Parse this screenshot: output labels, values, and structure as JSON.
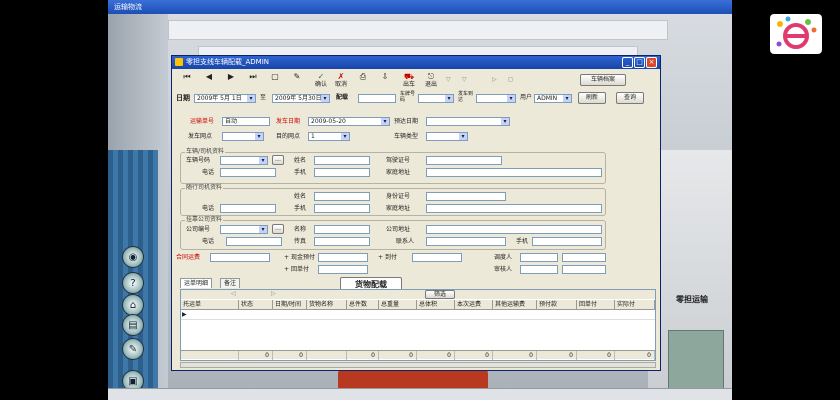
{
  "background": {
    "title": "运输物流",
    "right_label": "零担运输"
  },
  "dialog": {
    "title": "零担支线车辆配载_ADMIN",
    "toolbar": [
      {
        "label": "",
        "icon": "first-icon"
      },
      {
        "label": "",
        "icon": "prev-icon"
      },
      {
        "label": "",
        "icon": "next-icon"
      },
      {
        "label": "",
        "icon": "last-icon"
      },
      {
        "label": "",
        "icon": "new-icon"
      },
      {
        "label": "",
        "icon": "edit-icon"
      },
      {
        "label": "确认",
        "icon": "confirm-icon"
      },
      {
        "label": "取消",
        "icon": "cancel-icon"
      },
      {
        "label": "",
        "icon": "print-icon"
      },
      {
        "label": "",
        "icon": "export-icon"
      },
      {
        "label": "出车",
        "icon": "depart-icon"
      },
      {
        "label": "退出",
        "icon": "exit-icon"
      }
    ],
    "toolbar_right_button": "车辆档案",
    "filter": {
      "date_from_label": "日期",
      "date_from": "2009年 5月 1日",
      "date_to_label": "至",
      "date_to": "2009年 5月30日",
      "waybill_label": "配载",
      "plate_label": "车牌号码",
      "driver_label": "发车到达",
      "user_label": "用户",
      "user_value": "ADMIN",
      "search_button": "刷新",
      "query_button": "查询"
    },
    "form": {
      "dispatch_no_label": "运输单号",
      "dispatch_no": "自动",
      "depart_date_label": "发车日期",
      "depart_date": "2009-05-20",
      "arrive_date_label": "预达日期",
      "origin_label": "发车网点",
      "dest_label": "目的网点",
      "dest_value": "1",
      "vehicle_type_label": "车辆类型"
    },
    "group_vehicle": {
      "title": "车辆/司机资料",
      "plate_label": "车辆号码",
      "name_label": "姓名",
      "license_label": "驾驶证号",
      "phone_label": "电话",
      "mobile_label": "手机",
      "address_label": "家庭地址"
    },
    "group_escort": {
      "title": "随行司机资料",
      "name_label": "姓名",
      "id_label": "身份证号",
      "phone_label": "电话",
      "mobile_label": "手机",
      "address_label": "家庭地址"
    },
    "group_company": {
      "title": "挂靠公司资料",
      "code_label": "公司编号",
      "name_label": "名称",
      "address_label": "公司地址",
      "phone_label": "电话",
      "fax_label": "传真",
      "contact_label": "联系人",
      "mobile_label": "手机"
    },
    "settlement": {
      "contract_label": "合同运费",
      "prepay_label": "现金预付",
      "arrive_pay_label": "到付",
      "return_label": "回单付",
      "loader_label": "调度人",
      "checker_label": "审核人"
    },
    "tabs": [
      "运单明细",
      "备注"
    ],
    "overlay_button": "货物配载",
    "filter_tab": "筛选",
    "table": {
      "headers": [
        "托运单",
        "状态",
        "日期/时间",
        "货物名称",
        "总件数",
        "总重量",
        "总体积",
        "本次运费",
        "其他运输费",
        "预付款",
        "回单付",
        "实际付"
      ],
      "footer": [
        "",
        "0",
        "0",
        "",
        "0",
        "0",
        "0",
        "0",
        "0",
        "0",
        "0",
        "0"
      ]
    }
  }
}
